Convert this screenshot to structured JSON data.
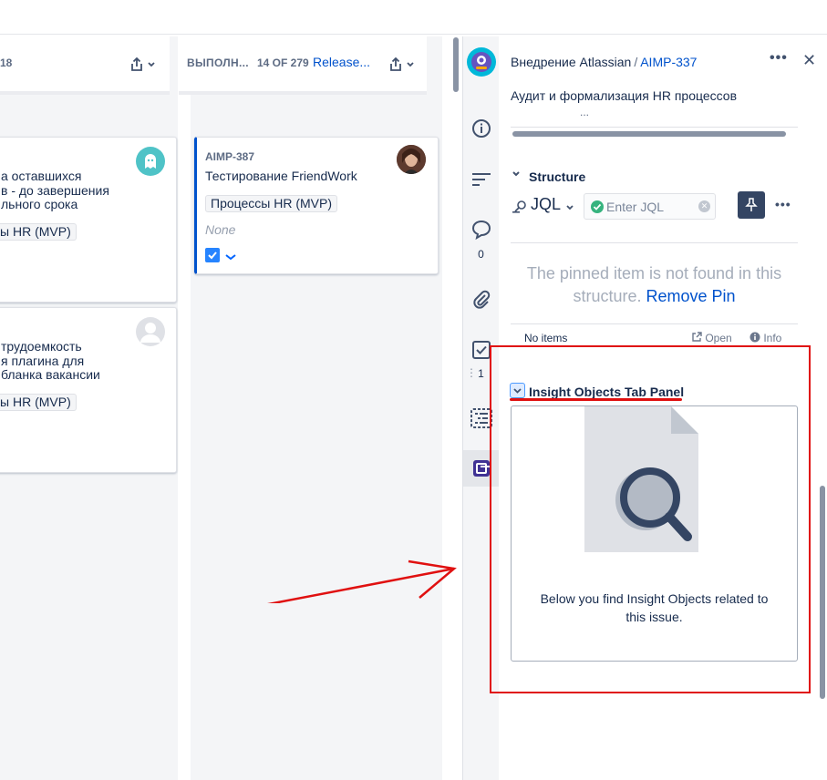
{
  "board": {
    "left_column": {
      "count": "18",
      "cards": [
        {
          "lines": [
            "а оставшихся",
            "в - до завершения",
            "льного срока"
          ],
          "label": "ы HR (MVP)"
        },
        {
          "lines": [
            "трудоемкость",
            "я плагина для",
            "бланка вакансии"
          ],
          "label": "ы HR (MVP)"
        }
      ]
    },
    "right_column": {
      "title": "ВЫПОЛН...",
      "count": "14 OF 279",
      "link": "Release...",
      "card": {
        "key": "AIMP-387",
        "summary": "Тестирование FriendWork",
        "label": "Процессы HR (MVP)",
        "none_text": "None"
      }
    }
  },
  "rail": {
    "comment_count": "0",
    "checklist_count": "1"
  },
  "issue": {
    "project": "Внедрение Atlassian",
    "separator": "/",
    "key": "AIMP-337",
    "title": "Аудит и формализация HR процессов",
    "clipped": "..."
  },
  "structure": {
    "title": "Structure",
    "jql_label": "JQL",
    "jql_placeholder": "Enter JQL",
    "pinned_message": "The pinned item is not found in this structure.",
    "remove_pin": "Remove Pin",
    "no_items": "No items",
    "open": "Open",
    "info": "Info"
  },
  "insight": {
    "title": "Insight Objects Tab Panel",
    "description": "Below you find Insight Objects related to this issue."
  },
  "colors": {
    "accent": "#0052cc",
    "annotation": "#e01010",
    "success": "#36b37e"
  }
}
